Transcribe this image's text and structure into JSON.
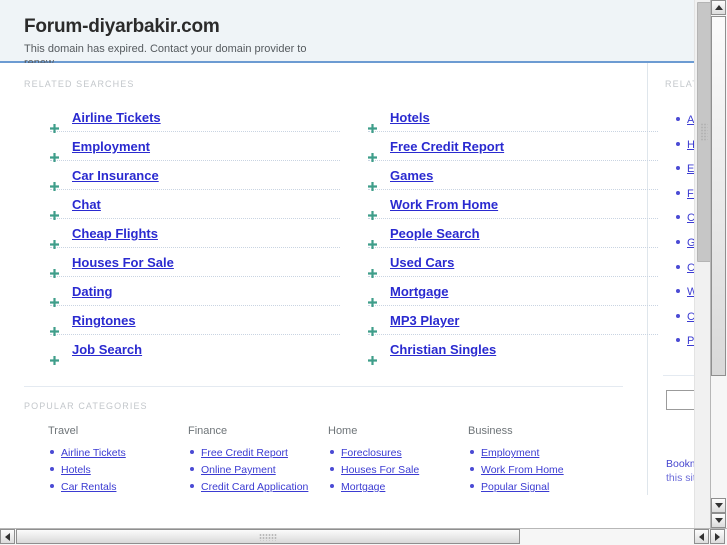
{
  "banner": {
    "title": "Forum-diyarbakir.com",
    "subtitle": "This domain has expired. Contact your domain provider to renew.",
    "bg_color": "#eff4f7",
    "border_color": "#6c9bd2"
  },
  "colors": {
    "link": "#2a2ad0",
    "label": "#c3c7cb",
    "arrow": "#3f9e8a",
    "divider": "#e4eaf1"
  },
  "related_searches": {
    "label": "RELATED SEARCHES",
    "left_column": [
      {
        "label": "Airline Tickets"
      },
      {
        "label": "Employment"
      },
      {
        "label": "Car Insurance"
      },
      {
        "label": "Chat"
      },
      {
        "label": "Cheap Flights"
      },
      {
        "label": "Houses For Sale"
      },
      {
        "label": "Dating"
      },
      {
        "label": "Ringtones"
      },
      {
        "label": "Job Search"
      }
    ],
    "right_column": [
      {
        "label": "Hotels"
      },
      {
        "label": "Free Credit Report"
      },
      {
        "label": "Games"
      },
      {
        "label": "Work From Home"
      },
      {
        "label": "People Search"
      },
      {
        "label": "Used Cars"
      },
      {
        "label": "Mortgage"
      },
      {
        "label": "MP3 Player"
      },
      {
        "label": "Christian Singles"
      }
    ]
  },
  "popular_categories": {
    "label": "POPULAR CATEGORIES",
    "columns": [
      {
        "heading": "Travel",
        "items": [
          "Airline Tickets",
          "Hotels",
          "Car Rentals"
        ]
      },
      {
        "heading": "Finance",
        "items": [
          "Free Credit Report",
          "Online Payment",
          "Credit Card Application"
        ]
      },
      {
        "heading": "Home",
        "items": [
          "Foreclosures",
          "Houses For Sale",
          "Mortgage"
        ]
      },
      {
        "heading": "Business",
        "items": [
          "Employment",
          "Work From Home",
          "Popular Signal"
        ]
      }
    ]
  },
  "aside": {
    "label": "RELATED",
    "items": [
      "Airline Tickets",
      "Hotels",
      "Employment",
      "Free Credit Report",
      "Car Insurance",
      "Games",
      "Chat",
      "Work From Home",
      "Cheap Flights",
      "People Search"
    ],
    "search_value": "",
    "search_placeholder": "",
    "bookmark_label": "Bookmark",
    "bookmark_label2": "this site"
  },
  "scrollbars": {
    "window_vertical": {
      "up_arrow": "▲",
      "down_arrow": "▼"
    },
    "window_horizontal": {
      "left_arrow": "◀",
      "right_arrow": "▶"
    }
  }
}
